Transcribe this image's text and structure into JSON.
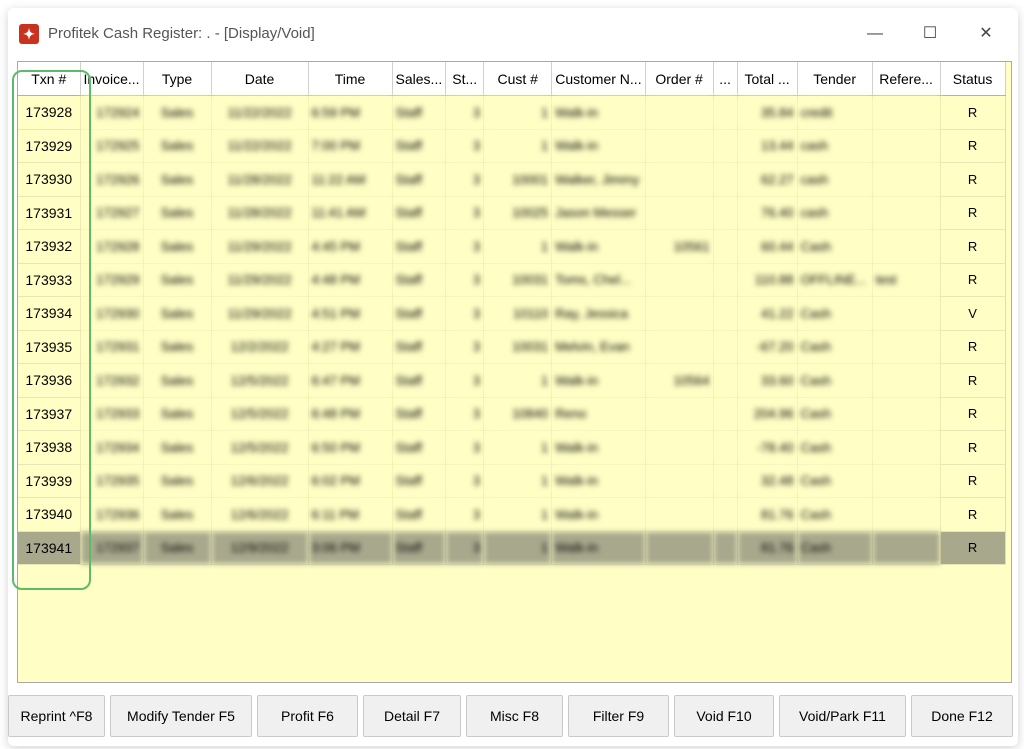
{
  "window": {
    "title": "Profitek Cash Register: . - [Display/Void]",
    "icon": "app-logo-icon"
  },
  "grid": {
    "columns": [
      "Txn #",
      "Invoice...",
      "Type",
      "Date",
      "Time",
      "Sales...",
      "St...",
      "Cust #",
      "Customer N...",
      "Order #",
      "...",
      "Total ...",
      "Tender",
      "Refere...",
      "Status"
    ],
    "rows": [
      {
        "txn": "173928",
        "invoice": "172924",
        "type": "Sales",
        "date": "11/22/2022",
        "time": "6:59 PM",
        "sales": "Staff",
        "st": "3",
        "cust": "1",
        "customer": "Walk-in",
        "order": "",
        "x": "",
        "total": "35.84",
        "tender": "credit",
        "ref": "",
        "status": "R"
      },
      {
        "txn": "173929",
        "invoice": "172925",
        "type": "Sales",
        "date": "11/22/2022",
        "time": "7:00 PM",
        "sales": "Staff",
        "st": "3",
        "cust": "1",
        "customer": "Walk-in",
        "order": "",
        "x": "",
        "total": "13.44",
        "tender": "cash",
        "ref": "",
        "status": "R"
      },
      {
        "txn": "173930",
        "invoice": "172926",
        "type": "Sales",
        "date": "11/28/2022",
        "time": "11:22 AM",
        "sales": "Staff",
        "st": "3",
        "cust": "10001",
        "customer": "Walker, Jimmy",
        "order": "",
        "x": "",
        "total": "62.27",
        "tender": "cash",
        "ref": "",
        "status": "R"
      },
      {
        "txn": "173931",
        "invoice": "172927",
        "type": "Sales",
        "date": "11/28/2022",
        "time": "11:41 AM",
        "sales": "Staff",
        "st": "3",
        "cust": "10025",
        "customer": "Jason Messer",
        "order": "",
        "x": "",
        "total": "76.40",
        "tender": "cash",
        "ref": "",
        "status": "R"
      },
      {
        "txn": "173932",
        "invoice": "172928",
        "type": "Sales",
        "date": "11/29/2022",
        "time": "4:45 PM",
        "sales": "Staff",
        "st": "3",
        "cust": "1",
        "customer": "Walk-in",
        "order": "10561",
        "x": "",
        "total": "60.44",
        "tender": "Cash",
        "ref": "",
        "status": "R"
      },
      {
        "txn": "173933",
        "invoice": "172929",
        "type": "Sales",
        "date": "11/29/2022",
        "time": "4:48 PM",
        "sales": "Staff",
        "st": "3",
        "cust": "10031",
        "customer": "Toms, Chel...",
        "order": "",
        "x": "",
        "total": "110.88",
        "tender": "OFFLINE...",
        "ref": "test",
        "status": "R"
      },
      {
        "txn": "173934",
        "invoice": "172930",
        "type": "Sales",
        "date": "11/29/2022",
        "time": "4:51 PM",
        "sales": "Staff",
        "st": "3",
        "cust": "10110",
        "customer": "Ray, Jessica",
        "order": "",
        "x": "",
        "total": "41.22",
        "tender": "Cash",
        "ref": "",
        "status": "V"
      },
      {
        "txn": "173935",
        "invoice": "172931",
        "type": "Sales",
        "date": "12/2/2022",
        "time": "4:27 PM",
        "sales": "Staff",
        "st": "3",
        "cust": "10031",
        "customer": "Melvin, Evan",
        "order": "",
        "x": "",
        "total": "-67.20",
        "tender": "Cash",
        "ref": "",
        "status": "R"
      },
      {
        "txn": "173936",
        "invoice": "172932",
        "type": "Sales",
        "date": "12/5/2022",
        "time": "6:47 PM",
        "sales": "Staff",
        "st": "3",
        "cust": "1",
        "customer": "Walk-in",
        "order": "10564",
        "x": "",
        "total": "33.60",
        "tender": "Cash",
        "ref": "",
        "status": "R"
      },
      {
        "txn": "173937",
        "invoice": "172933",
        "type": "Sales",
        "date": "12/5/2022",
        "time": "6:48 PM",
        "sales": "Staff",
        "st": "3",
        "cust": "10840",
        "customer": "Reno",
        "order": "",
        "x": "",
        "total": "204.96",
        "tender": "Cash",
        "ref": "",
        "status": "R"
      },
      {
        "txn": "173938",
        "invoice": "172934",
        "type": "Sales",
        "date": "12/5/2022",
        "time": "6:50 PM",
        "sales": "Staff",
        "st": "3",
        "cust": "1",
        "customer": "Walk-in",
        "order": "",
        "x": "",
        "total": "-78.40",
        "tender": "Cash",
        "ref": "",
        "status": "R"
      },
      {
        "txn": "173939",
        "invoice": "172935",
        "type": "Sales",
        "date": "12/6/2022",
        "time": "6:02 PM",
        "sales": "Staff",
        "st": "3",
        "cust": "1",
        "customer": "Walk-in",
        "order": "",
        "x": "",
        "total": "32.48",
        "tender": "Cash",
        "ref": "",
        "status": "R"
      },
      {
        "txn": "173940",
        "invoice": "172936",
        "type": "Sales",
        "date": "12/6/2022",
        "time": "6:11 PM",
        "sales": "Staff",
        "st": "3",
        "cust": "1",
        "customer": "Walk-in",
        "order": "",
        "x": "",
        "total": "81.76",
        "tender": "Cash",
        "ref": "",
        "status": "R"
      },
      {
        "txn": "173941",
        "invoice": "172937",
        "type": "Sales",
        "date": "12/9/2022",
        "time": "3:06 PM",
        "sales": "Staff",
        "st": "3",
        "cust": "1",
        "customer": "Walk-in",
        "order": "",
        "x": "",
        "total": "81.76",
        "tender": "Cash",
        "ref": "",
        "status": "R",
        "selected": true
      }
    ]
  },
  "buttons": [
    {
      "name": "reprint-button",
      "label": "Reprint ^F8"
    },
    {
      "name": "modify-tender-button",
      "label": "Modify Tender F5"
    },
    {
      "name": "profit-button",
      "label": "Profit F6"
    },
    {
      "name": "detail-button",
      "label": "Detail F7"
    },
    {
      "name": "misc-button",
      "label": "Misc F8"
    },
    {
      "name": "filter-button",
      "label": "Filter F9"
    },
    {
      "name": "void-button",
      "label": "Void F10"
    },
    {
      "name": "void-park-button",
      "label": "Void/Park F11"
    },
    {
      "name": "done-button",
      "label": "Done F12"
    }
  ],
  "colors": {
    "grid_background": "#fffec4",
    "selected_row": "#a8a88d",
    "highlight_outline": "#5cba6a",
    "app_icon": "#c8321f"
  }
}
